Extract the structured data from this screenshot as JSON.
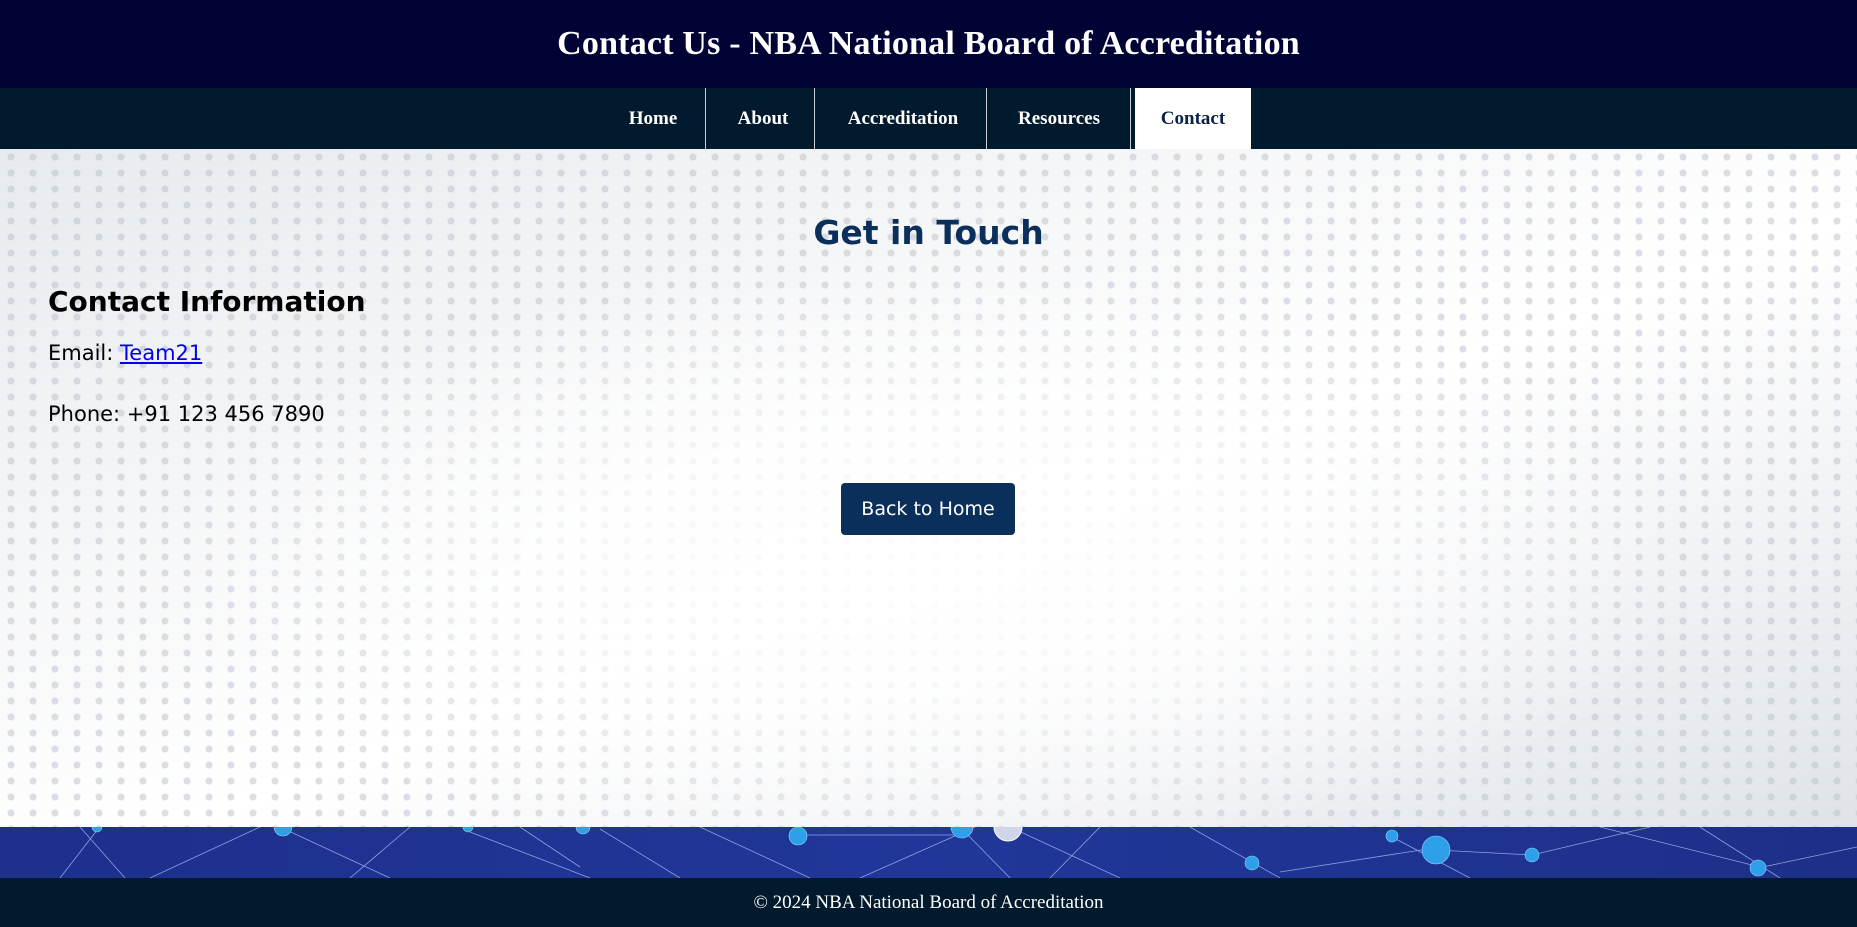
{
  "header": {
    "title": "Contact Us - NBA National Board of Accreditation"
  },
  "nav": {
    "items": [
      {
        "label": "Home"
      },
      {
        "label": "About"
      },
      {
        "label": "Accreditation"
      },
      {
        "label": "Resources"
      },
      {
        "label": "Contact",
        "active": true
      }
    ]
  },
  "main": {
    "title": "Get in Touch",
    "contact_heading": "Contact Information",
    "email_label": "Email: ",
    "email_link_text": "Team21",
    "phone_text": "Phone: +91 123 456 7890",
    "back_button_label": "Back to Home"
  },
  "footer": {
    "text": "© 2024 NBA National Board of Accreditation"
  },
  "colors": {
    "header_bg": "#020335",
    "nav_bg": "#021a2e",
    "accent": "#0b2f5b",
    "link": "#0000ee",
    "network_band": "#203799"
  }
}
